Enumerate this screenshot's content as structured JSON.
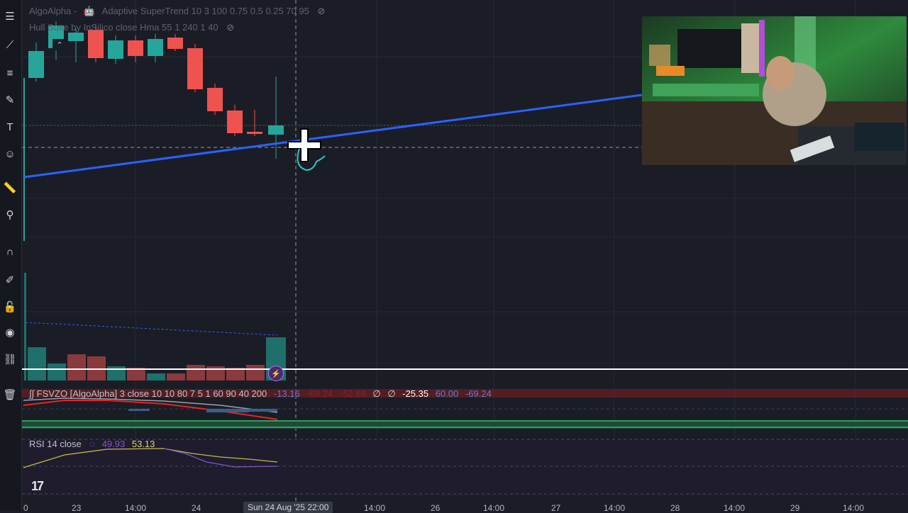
{
  "indicators": {
    "supertrend": {
      "name": "AlgoAlpha -",
      "emoji": "🤖",
      "label": "Adaptive SuperTrend 10 3 100 0.75 0.5 0.25 70 95"
    },
    "hull": {
      "label": "Hull Suite by InSilico close Hma 55 1 240 1 40"
    },
    "fsvzo": {
      "label": "∫∫ FSVZO [AlgoAlpha] 3 close 10 10 80 7 5 1 60 90 40 200",
      "values": [
        "-13.16",
        "-69.24",
        "-52.68",
        "∅",
        "∅",
        "-25.35",
        "60.00",
        "-69.24"
      ]
    },
    "rsi": {
      "label": "RSI 14 close",
      "values": [
        "49.93",
        "53.13"
      ]
    }
  },
  "time_axis": {
    "labels": [
      "0",
      "23",
      "14:00",
      "24",
      "14:00",
      "26",
      "14:00",
      "27",
      "14:00",
      "28",
      "14:00",
      "29",
      "14:00"
    ],
    "cursor_label": "Sun 24 Aug '25  22:00"
  },
  "tv_logo": "17",
  "collapse_icon": "chevron-up",
  "colors": {
    "bg": "#1b1d26",
    "up": "#26a69a",
    "down": "#ef5350",
    "hull": "#2962ff",
    "rsi": "#c7b74a",
    "rsi_ma": "#7e57c2"
  }
}
